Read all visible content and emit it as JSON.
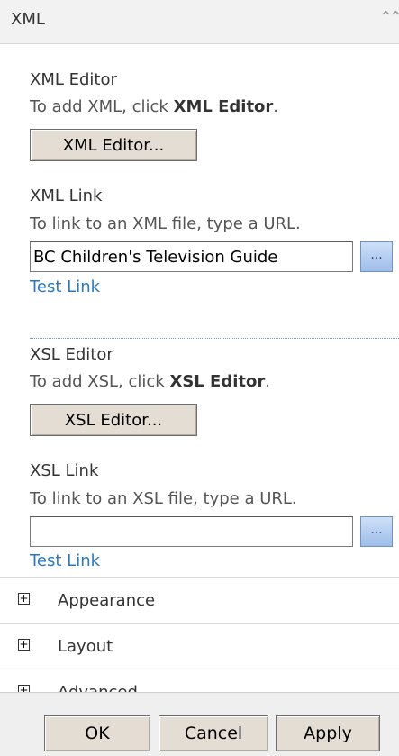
{
  "header": {
    "title": "XML",
    "collapse_glyph": "⌃⌃"
  },
  "xml_editor": {
    "heading": "XML Editor",
    "desc_prefix": "To add XML, click ",
    "desc_bold": "XML Editor",
    "desc_suffix": ".",
    "button_label": "XML Editor..."
  },
  "xml_link": {
    "heading": "XML Link",
    "desc": "To link to an XML file, type a URL.",
    "value": "BC Children's Television Guide",
    "browse_label": "...",
    "test_link": "Test Link"
  },
  "xsl_editor": {
    "heading": "XSL Editor",
    "desc_prefix": "To add XSL, click ",
    "desc_bold": "XSL Editor",
    "desc_suffix": ".",
    "button_label": "XSL Editor..."
  },
  "xsl_link": {
    "heading": "XSL Link",
    "desc": "To link to an XSL file, type a URL.",
    "value": "",
    "browse_label": "...",
    "test_link": "Test Link"
  },
  "categories": [
    {
      "label": "Appearance",
      "expander": "+"
    },
    {
      "label": "Layout",
      "expander": "+"
    },
    {
      "label": "Advanced",
      "expander": "+"
    }
  ],
  "footer": {
    "ok": "OK",
    "cancel": "Cancel",
    "apply": "Apply"
  }
}
